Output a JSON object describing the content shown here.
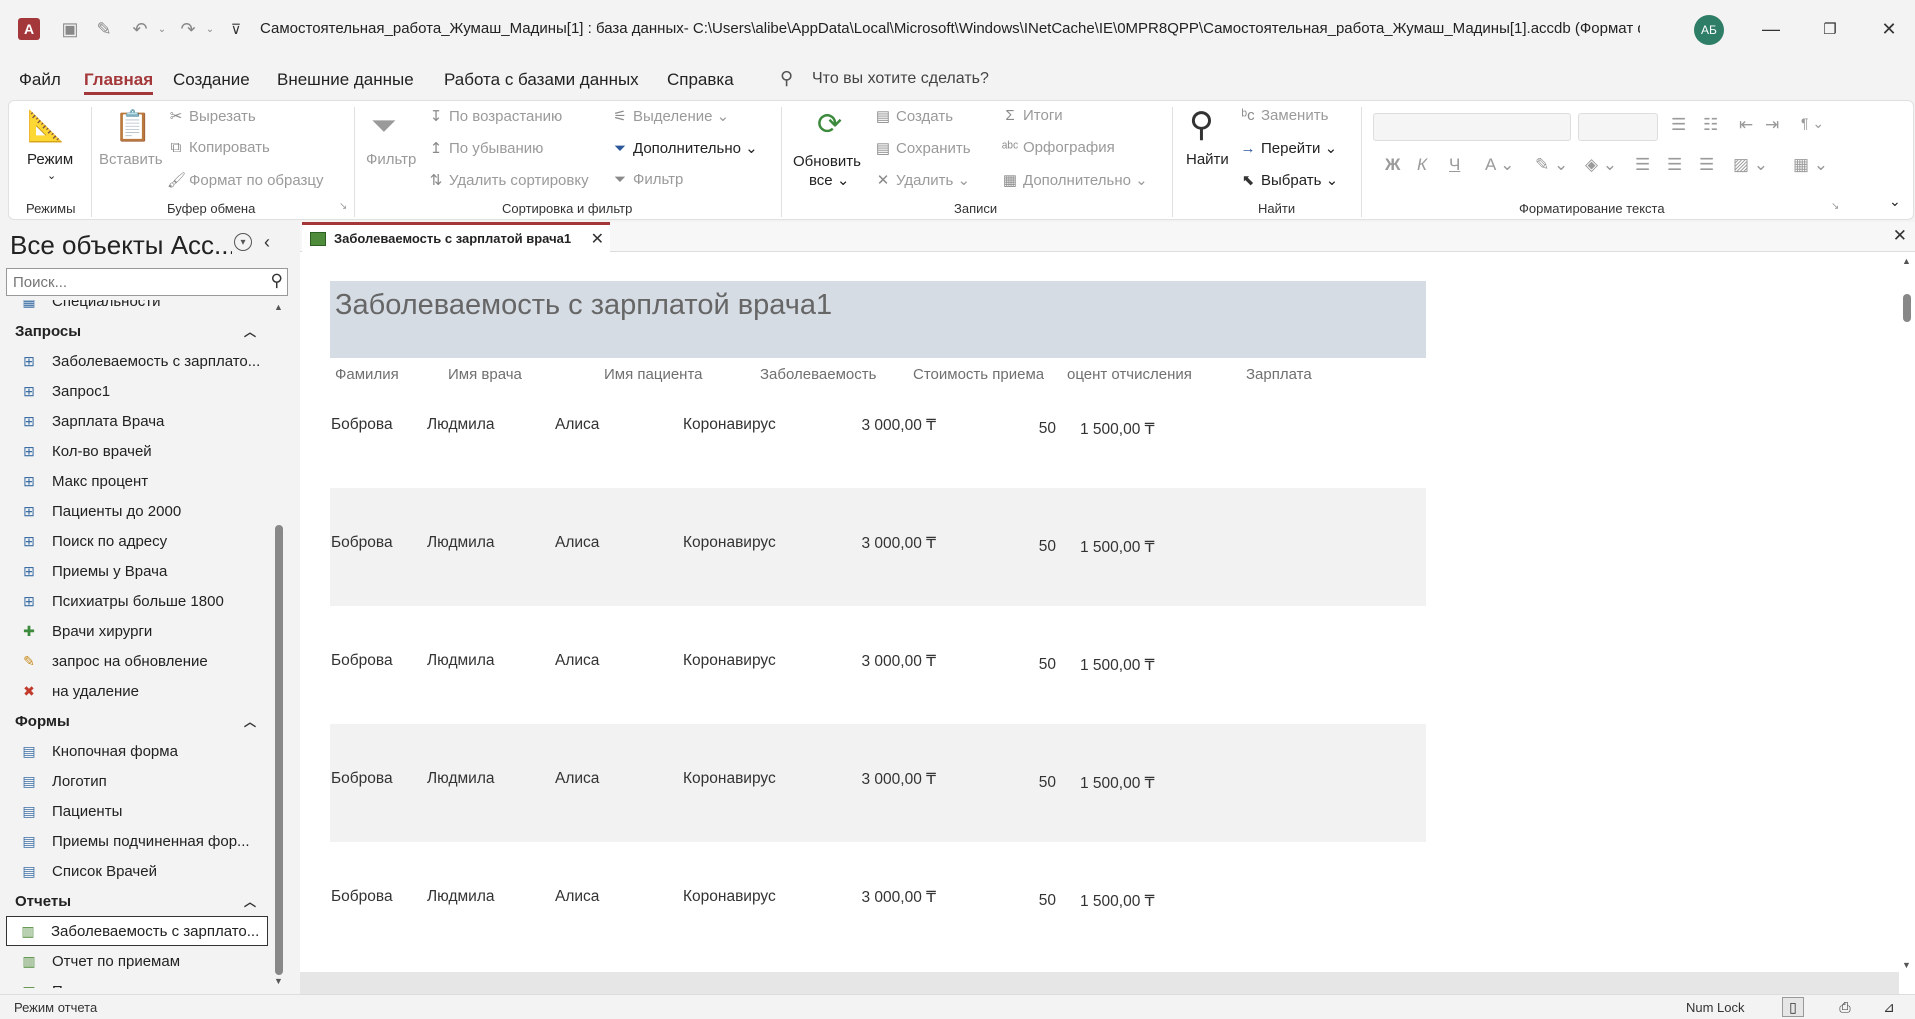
{
  "window": {
    "title": "Самостоятельная_работа_Жумаш_Мадины[1] : база данных- C:\\Users\\alibe\\AppData\\Local\\Microsoft\\Windows\\INetCache\\IE\\0MPR8QPP\\Самостоятельная_работа_Жумаш_Мадины[1].accdb (Формат ф...",
    "app_logo": "A",
    "avatar_initials": "АБ"
  },
  "menu": {
    "tabs": [
      "Файл",
      "Главная",
      "Создание",
      "Внешние данные",
      "Работа с базами данных",
      "Справка"
    ],
    "active_tab": "Главная",
    "search_placeholder": "Что вы хотите сделать?"
  },
  "ribbon": {
    "groups": {
      "modes": "Режимы",
      "clipboard": "Буфер обмена",
      "sort_filter": "Сортировка и фильтр",
      "records": "Записи",
      "find": "Найти",
      "text_format": "Форматирование текста"
    },
    "mode_label": "Режим",
    "paste_label": "Вставить",
    "cut_label": "Вырезать",
    "copy_label": "Копировать",
    "format_painter_label": "Формат по образцу",
    "filter_label": "Фильтр",
    "asc_label": "По возрастанию",
    "desc_label": "По убыванию",
    "remove_sort_label": "Удалить сортировку",
    "selection_label": "Выделение",
    "advanced_label": "Дополнительно",
    "toggle_filter_label": "Фильтр",
    "refresh_label_1": "Обновить",
    "refresh_label_2": "все",
    "new_label": "Создать",
    "save_label": "Сохранить",
    "delete_label": "Удалить",
    "totals_label": "Итоги",
    "spelling_label": "Орфография",
    "more_label": "Дополнительно",
    "find_label": "Найти",
    "replace_label": "Заменить",
    "goto_label": "Перейти",
    "select_label": "Выбрать",
    "bold": "Ж",
    "italic": "К",
    "underline": "Ч"
  },
  "nav": {
    "title": "Все объекты Acc...",
    "search_placeholder": "Поиск...",
    "items": [
      {
        "type": "table",
        "label": "Специальности"
      },
      {
        "type": "group",
        "label": "Запросы"
      },
      {
        "type": "query",
        "label": "Заболеваемость с зарплато..."
      },
      {
        "type": "query",
        "label": "Запрос1"
      },
      {
        "type": "query",
        "label": "Зарплата Врача"
      },
      {
        "type": "query",
        "label": "Кол-во врачей"
      },
      {
        "type": "query",
        "label": "Макс процент"
      },
      {
        "type": "query",
        "label": "Пациенты до 2000"
      },
      {
        "type": "query",
        "label": "Поиск по адресу"
      },
      {
        "type": "query",
        "label": "Приемы у Врача"
      },
      {
        "type": "query",
        "label": "Психиатры больше 1800"
      },
      {
        "type": "append",
        "label": "Врачи хирурги"
      },
      {
        "type": "update",
        "label": "запрос на обновление"
      },
      {
        "type": "delete",
        "label": "на удаление"
      },
      {
        "type": "group",
        "label": "Формы"
      },
      {
        "type": "form",
        "label": "Кнопочная форма"
      },
      {
        "type": "form",
        "label": "Логотип"
      },
      {
        "type": "form",
        "label": "Пациенты"
      },
      {
        "type": "form",
        "label": "Приемы подчиненная фор..."
      },
      {
        "type": "form",
        "label": "Список Врачей"
      },
      {
        "type": "group",
        "label": "Отчеты"
      },
      {
        "type": "report",
        "label": "Заболеваемость с зарплато...",
        "selected": true
      },
      {
        "type": "report",
        "label": "Отчет по приемам"
      },
      {
        "type": "report",
        "label": "Пациенты"
      }
    ]
  },
  "document": {
    "tab_label": "Заболеваемость с зарплатой врача1",
    "report_title": "Заболеваемость с зарплатой врача1",
    "columns": [
      "Фамилия",
      "Имя врача",
      "Имя пациента",
      "Заболеваемость",
      "Стоимость приема",
      "оцент отчисления",
      "Зарплата"
    ],
    "rows": [
      [
        "Боброва",
        "Людмила",
        "Алиса",
        "Коронавирус",
        "3 000,00 ₸",
        "50",
        "1 500,00 ₸"
      ],
      [
        "Боброва",
        "Людмила",
        "Алиса",
        "Коронавирус",
        "3 000,00 ₸",
        "50",
        "1 500,00 ₸"
      ],
      [
        "Боброва",
        "Людмила",
        "Алиса",
        "Коронавирус",
        "3 000,00 ₸",
        "50",
        "1 500,00 ₸"
      ],
      [
        "Боброва",
        "Людмила",
        "Алиса",
        "Коронавирус",
        "3 000,00 ₸",
        "50",
        "1 500,00 ₸"
      ],
      [
        "Боброва",
        "Людмила",
        "Алиса",
        "Коронавирус",
        "3 000,00 ₸",
        "50",
        "1 500,00 ₸"
      ]
    ]
  },
  "status": {
    "left": "Режим отчета",
    "numlock": "Num Lock"
  },
  "colors": {
    "accent": "#a4373a",
    "report_header_bg": "#d6dce4",
    "avatar_bg": "#2e7d66"
  }
}
